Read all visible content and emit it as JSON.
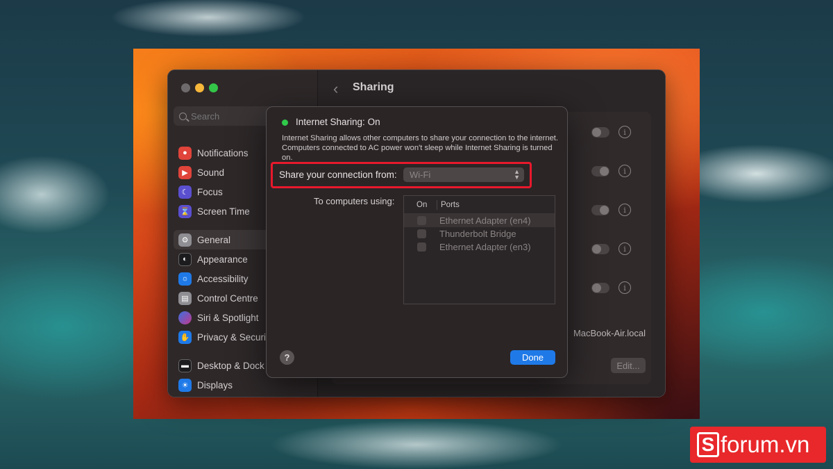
{
  "window": {
    "title": "Sharing"
  },
  "search": {
    "placeholder": "Search"
  },
  "sidebar": {
    "items": [
      {
        "label": "Notifications",
        "icon": "bell-icon",
        "color": "#e0443a"
      },
      {
        "label": "Sound",
        "icon": "speaker-icon",
        "color": "#e0443a"
      },
      {
        "label": "Focus",
        "icon": "moon-icon",
        "color": "#5a4fcf"
      },
      {
        "label": "Screen Time",
        "icon": "hourglass-icon",
        "color": "#5a4fcf"
      },
      {
        "label": "General",
        "icon": "gear-icon",
        "color": "#8e8e93"
      },
      {
        "label": "Appearance",
        "icon": "appearance-icon",
        "color": "#1c1c1e"
      },
      {
        "label": "Accessibility",
        "icon": "accessibility-icon",
        "color": "#1f7ae8"
      },
      {
        "label": "Control Centre",
        "icon": "control-centre-icon",
        "color": "#8e8e93"
      },
      {
        "label": "Siri & Spotlight",
        "icon": "siri-icon",
        "color": "#c2388c"
      },
      {
        "label": "Privacy & Security",
        "icon": "hand-icon",
        "color": "#1f7ae8"
      },
      {
        "label": "Desktop & Dock",
        "icon": "dock-icon",
        "color": "#1c1c1e"
      },
      {
        "label": "Displays",
        "icon": "sun-icon",
        "color": "#1f7ae8"
      }
    ]
  },
  "main": {
    "rows": [
      {
        "toggle": false
      },
      {
        "toggle": true
      },
      {
        "toggle": true
      },
      {
        "toggle": false
      },
      {
        "toggle": false
      }
    ],
    "hostname": "MacBook-Air.local",
    "edit_label": "Edit..."
  },
  "sheet": {
    "status": "Internet Sharing: On",
    "status_color": "#30c94a",
    "description": "Internet Sharing allows other computers to share your connection to the internet. Computers connected to AC power won't sleep while Internet Sharing is turned on.",
    "share_from_label": "Share your connection from:",
    "share_from_value": "Wi-Fi",
    "to_computers_label": "To computers using:",
    "table": {
      "col_on": "On",
      "col_ports": "Ports",
      "rows": [
        {
          "port": "Ethernet Adapter (en4)",
          "on": false
        },
        {
          "port": "Thunderbolt Bridge",
          "on": false
        },
        {
          "port": "Ethernet Adapter (en3)",
          "on": false
        }
      ]
    },
    "help_label": "?",
    "done_label": "Done"
  },
  "watermark": {
    "text": "forum.vn",
    "letter": "S"
  }
}
